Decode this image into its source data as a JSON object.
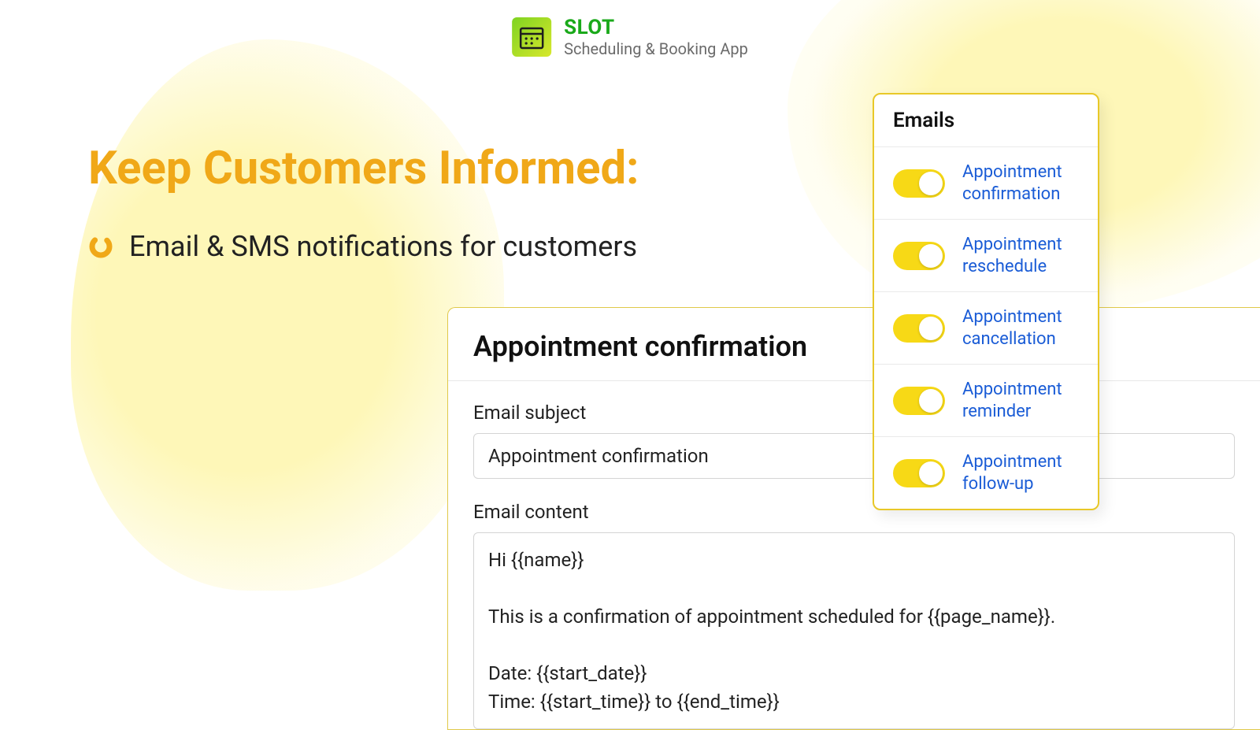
{
  "brand": {
    "name": "SLOT",
    "subtitle": "Scheduling & Booking App"
  },
  "heading": "Keep Customers Informed:",
  "bullet_text": "Email & SMS notifications for customers",
  "confirm_panel": {
    "title": "Appointment confirmation",
    "subject_label": "Email subject",
    "subject_value": "Appointment confirmation",
    "content_label": "Email content",
    "content_value": "Hi {{name}}\n\nThis is a confirmation of appointment scheduled for {{page_name}}.\n\nDate: {{start_date}}\nTime: {{start_time}} to {{end_time}}"
  },
  "emails_panel": {
    "title": "Emails",
    "items": [
      {
        "label": "Appointment confirmation",
        "enabled": true
      },
      {
        "label": "Appointment reschedule",
        "enabled": true
      },
      {
        "label": "Appointment cancellation",
        "enabled": true
      },
      {
        "label": "Appointment reminder",
        "enabled": true
      },
      {
        "label": "Appointment follow-up",
        "enabled": true
      }
    ]
  },
  "colors": {
    "accent_yellow": "#f7d916",
    "heading_orange": "#f0a818",
    "link_blue": "#1a5cd6"
  }
}
